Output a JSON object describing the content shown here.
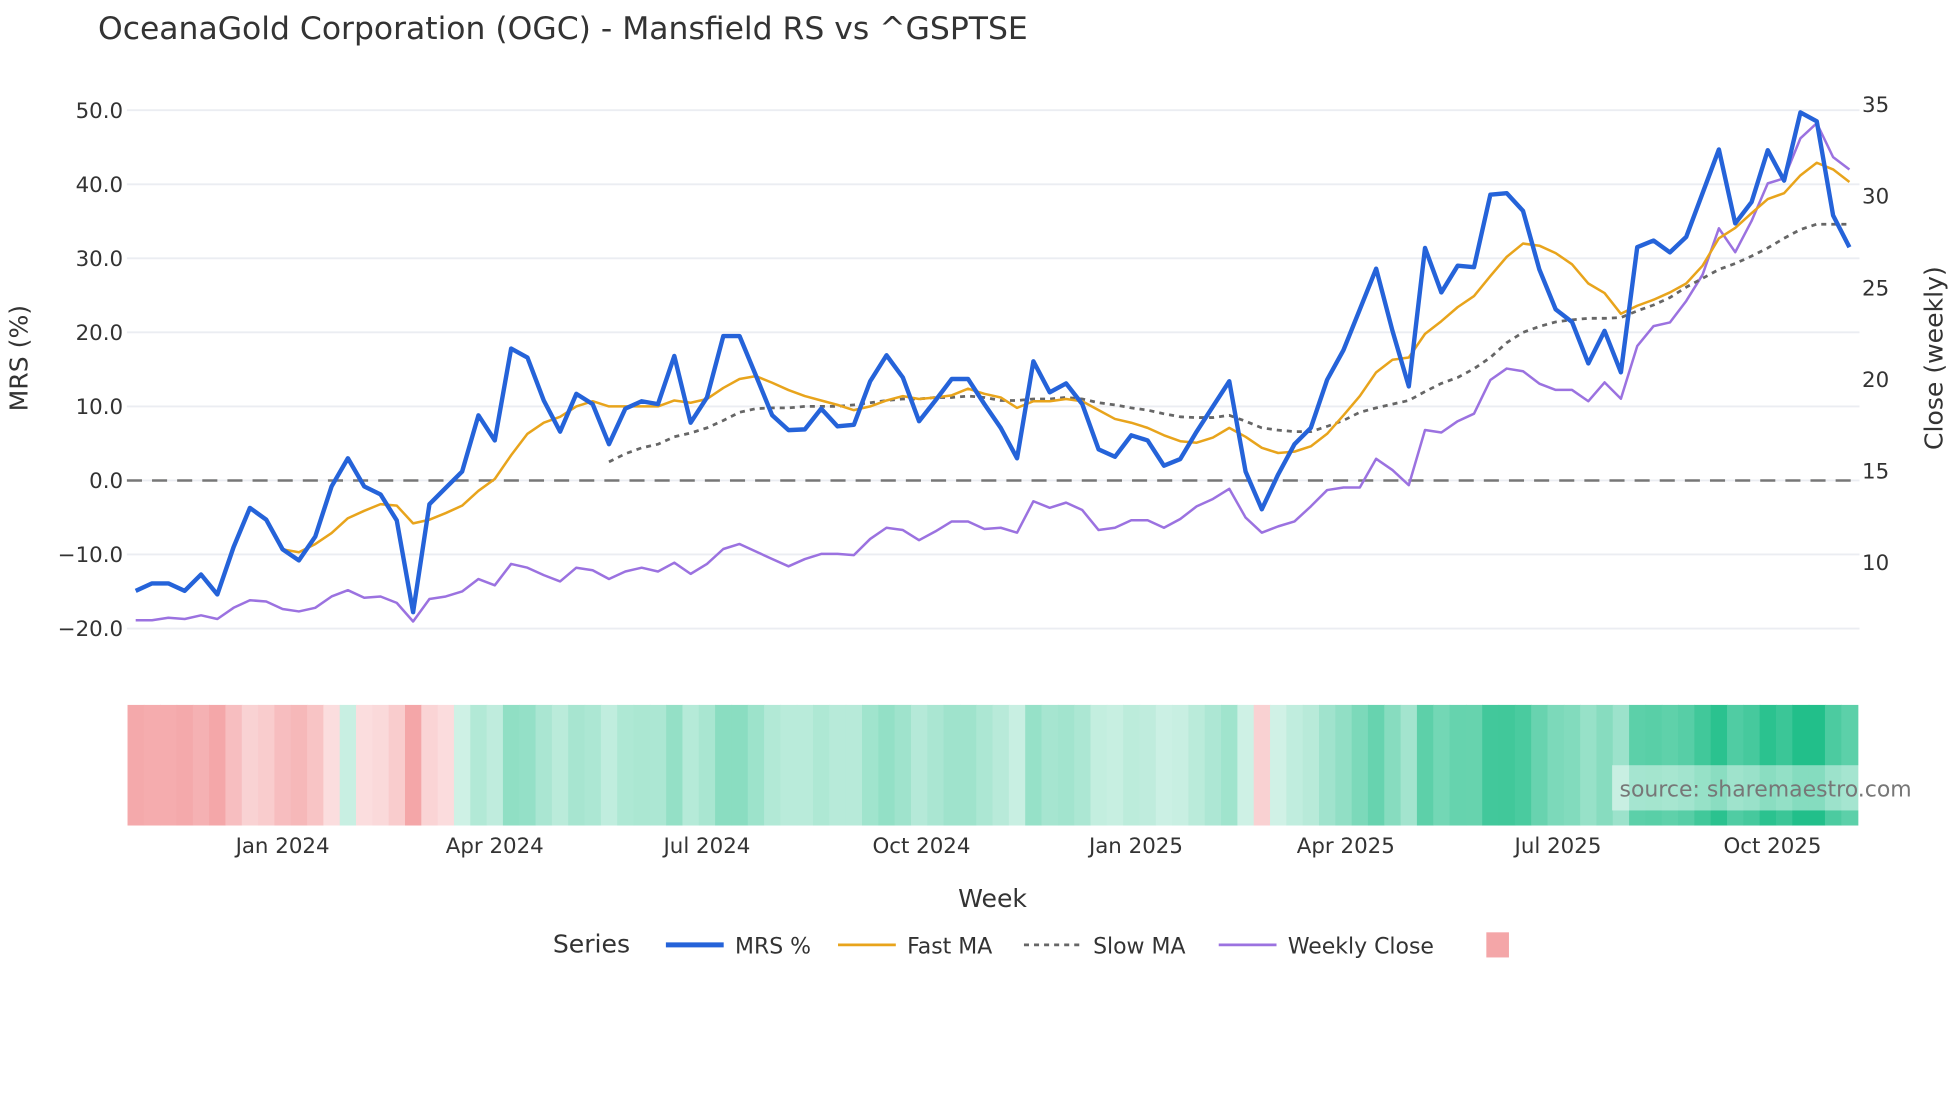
{
  "chart_data": {
    "type": "line",
    "title": "OceanaGold Corporation (OGC) - Mansfield RS vs ^GSPTSE",
    "xlabel": "Week",
    "ylabel": "MRS (%)",
    "y2label": "Close (weekly)",
    "start_week": "2023-10-30",
    "ylim": [
      -22,
      53
    ],
    "y2lim": [
      5.6,
      35.9
    ],
    "yticks": [
      "50.0",
      "40.0",
      "30.0",
      "20.0",
      "10.0",
      "0.0",
      "−10.0",
      "−20.0"
    ],
    "ytick_values": [
      50,
      40,
      30,
      20,
      10,
      0,
      -10,
      -20
    ],
    "y2ticks": [
      "35",
      "30",
      "25",
      "20",
      "15",
      "10"
    ],
    "y2tick_values": [
      35,
      30,
      25,
      20,
      15,
      10
    ],
    "xticks": [
      {
        "label": "Jan 2024",
        "date": "2024-01-01"
      },
      {
        "label": "Apr 2024",
        "date": "2024-04-01"
      },
      {
        "label": "Jul 2024",
        "date": "2024-07-01"
      },
      {
        "label": "Oct 2024",
        "date": "2024-10-01"
      },
      {
        "label": "Jan 2025",
        "date": "2025-01-01"
      },
      {
        "label": "Apr 2025",
        "date": "2025-04-01"
      },
      {
        "label": "Jul 2025",
        "date": "2025-07-01"
      },
      {
        "label": "Oct 2025",
        "date": "2025-10-01"
      }
    ],
    "zero_line": 0,
    "grid": true,
    "legend_position": "bottom",
    "legend_title": "Series",
    "series": [
      {
        "name": "MRS %",
        "color": "#2563d9",
        "axis": "y",
        "start": 0,
        "values": [
          -14.9,
          -13.9,
          -13.9,
          -14.9,
          -12.7,
          -15.4,
          -9,
          -3.7,
          -5.3,
          -9.3,
          -10.8,
          -7.6,
          -0.8,
          3.0,
          -0.8,
          -1.9,
          -5.4,
          -17.8,
          -3.2,
          -1.0,
          1.2,
          8.8,
          5.4,
          17.8,
          16.6,
          10.8,
          6.6,
          11.7,
          10.3,
          4.9,
          9.7,
          10.7,
          10.3,
          16.8,
          7.8,
          11.2,
          19.5,
          19.5,
          14.2,
          8.8,
          6.8,
          6.9,
          9.7,
          7.3,
          7.5,
          13.4,
          16.9,
          13.9,
          8.0,
          10.8,
          13.7,
          13.7,
          10.3,
          7.1,
          3.0,
          16.1,
          11.9,
          13.1,
          10.3,
          4.2,
          3.2,
          6.1,
          5.4,
          2.0,
          2.9,
          6.6,
          10,
          13.4,
          1.2,
          -3.9,
          0.8,
          4.9,
          7.1,
          13.6,
          17.6,
          23.1,
          28.6,
          20.2,
          12.7,
          31.4,
          25.4,
          29,
          28.8,
          38.6,
          38.8,
          36.4,
          28.5,
          23.1,
          21.4,
          15.8,
          20.2,
          14.6,
          31.5,
          32.4,
          30.8,
          32.9,
          38.8,
          44.7,
          34.7,
          37.6,
          44.6,
          40.5,
          49.7,
          48.5,
          35.8,
          31.5
        ]
      },
      {
        "name": "Fast MA",
        "color": "#e8a41c",
        "axis": "y",
        "start": 9,
        "values": [
          -9.3,
          -9.7,
          -8.6,
          -7.1,
          -5.1,
          -4.1,
          -3.2,
          -3.4,
          -5.8,
          -5.3,
          -4.4,
          -3.4,
          -1.4,
          0.2,
          3.4,
          6.3,
          7.8,
          8.6,
          10,
          10.7,
          10,
          10,
          10,
          10,
          10.8,
          10.5,
          11,
          12.5,
          13.7,
          14.1,
          13.2,
          12.2,
          11.4,
          10.8,
          10.2,
          9.5,
          10,
          10.8,
          11.4,
          11,
          11.2,
          11.5,
          12.4,
          11.7,
          11.2,
          9.8,
          10.7,
          10.7,
          11,
          10.7,
          9.5,
          8.3,
          7.8,
          7.1,
          6.1,
          5.3,
          5.1,
          5.8,
          7.1,
          5.9,
          4.4,
          3.7,
          3.9,
          4.6,
          6.3,
          8.8,
          11.4,
          14.6,
          16.3,
          16.6,
          19.8,
          21.5,
          23.4,
          24.9,
          27.6,
          30.2,
          32,
          31.7,
          30.7,
          29.2,
          26.6,
          25.3,
          22.5,
          23.6,
          24.4,
          25.4,
          26.6,
          29,
          32.7,
          34.1,
          36.1,
          38,
          38.8,
          41.2,
          42.9,
          42,
          40.3
        ]
      },
      {
        "name": "Slow MA",
        "color": "#666666",
        "axis": "y",
        "dash": true,
        "start": 29,
        "values": [
          2.5,
          3.6,
          4.4,
          4.9,
          5.9,
          6.4,
          7.1,
          8.1,
          9.2,
          9.7,
          9.8,
          9.8,
          10,
          10,
          10,
          10.2,
          10.5,
          10.8,
          11,
          11,
          11.2,
          11.2,
          11.4,
          11.2,
          10.8,
          10.8,
          11,
          11,
          11.2,
          11,
          10.5,
          10.2,
          9.8,
          9.5,
          9,
          8.6,
          8.5,
          8.5,
          8.8,
          8,
          7.1,
          6.8,
          6.6,
          6.6,
          7.3,
          8.1,
          9.2,
          9.8,
          10.3,
          10.8,
          12,
          13.1,
          13.9,
          15.1,
          16.6,
          18.6,
          20,
          20.8,
          21.4,
          21.7,
          21.9,
          21.9,
          22,
          22.9,
          23.7,
          24.7,
          26.1,
          27.3,
          28.5,
          29.3,
          30.3,
          31.4,
          32.7,
          33.9,
          34.6,
          34.6,
          34.6
        ]
      },
      {
        "name": "Weekly Close",
        "color": "#9b72e0",
        "axis": "y2",
        "start": 0,
        "values": [
          6.86,
          6.86,
          7.0,
          6.93,
          7.13,
          6.93,
          7.54,
          7.95,
          7.88,
          7.47,
          7.34,
          7.54,
          8.16,
          8.5,
          8.09,
          8.16,
          7.81,
          6.79,
          8.02,
          8.16,
          8.43,
          9.11,
          8.77,
          9.93,
          9.73,
          9.32,
          8.98,
          9.73,
          9.59,
          9.11,
          9.52,
          9.73,
          9.52,
          10.0,
          9.39,
          9.93,
          10.75,
          11.02,
          10.61,
          10.2,
          9.8,
          10.2,
          10.48,
          10.48,
          10.41,
          11.3,
          11.91,
          11.78,
          11.23,
          11.71,
          12.25,
          12.25,
          11.84,
          11.91,
          11.64,
          13.35,
          13.0,
          13.28,
          12.87,
          11.78,
          11.91,
          12.32,
          12.32,
          11.91,
          12.39,
          13.07,
          13.48,
          14.03,
          12.46,
          11.64,
          11.98,
          12.25,
          13.07,
          13.96,
          14.1,
          14.1,
          15.67,
          15.05,
          14.23,
          17.24,
          17.1,
          17.72,
          18.13,
          19.97,
          20.59,
          20.45,
          19.77,
          19.43,
          19.43,
          18.81,
          19.84,
          18.95,
          21.82,
          22.91,
          23.11,
          24.28,
          25.71,
          28.24,
          26.94,
          28.65,
          30.7,
          30.97,
          33.16,
          33.98,
          32.13,
          31.45
        ]
      }
    ],
    "heatmap": {
      "negative_color": "#f4a6a8",
      "positive_color": "#22bf8a",
      "legend_swatch_color": "#f4a6a8"
    }
  },
  "watermark": "source: sharemaestro.com"
}
